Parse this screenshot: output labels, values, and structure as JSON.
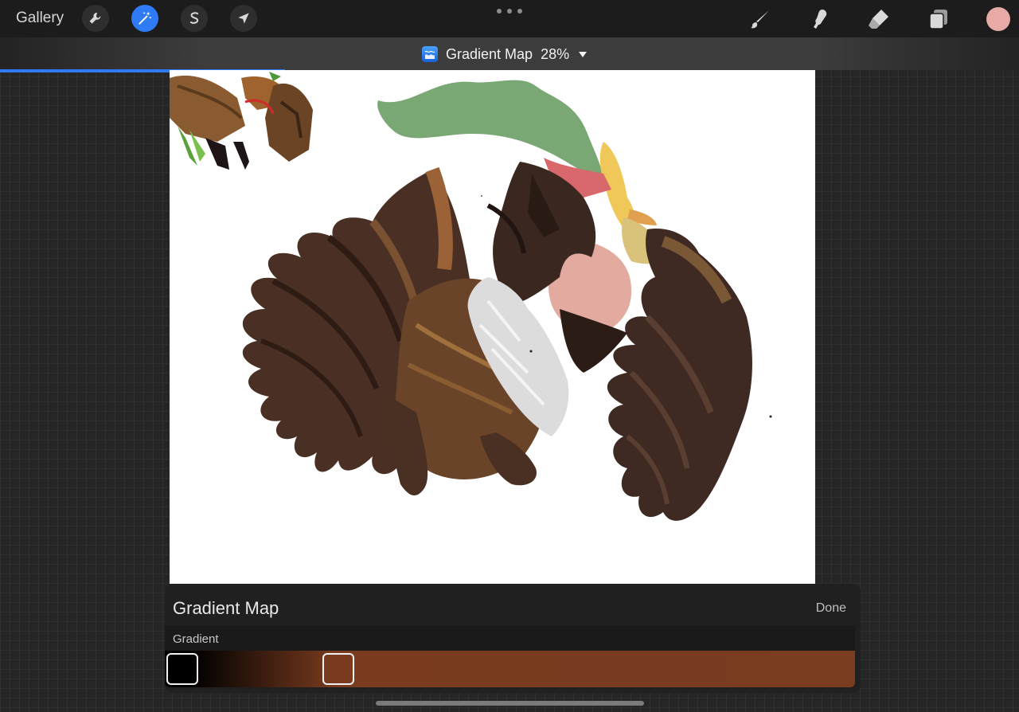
{
  "toolbar": {
    "gallery_label": "Gallery",
    "tools_left": [
      {
        "name": "actions",
        "icon": "wrench-icon",
        "active": false
      },
      {
        "name": "adjustments",
        "icon": "magic-wand-icon",
        "active": true
      },
      {
        "name": "selection",
        "icon": "selection-s-icon",
        "active": false
      },
      {
        "name": "transform",
        "icon": "arrow-cursor-icon",
        "active": false
      }
    ],
    "tools_right": [
      {
        "name": "brush",
        "icon": "brush-icon"
      },
      {
        "name": "smudge",
        "icon": "smudge-finger-icon"
      },
      {
        "name": "eraser",
        "icon": "eraser-icon"
      },
      {
        "name": "layers",
        "icon": "layers-icon"
      }
    ],
    "current_color": "#e8aaa4"
  },
  "adjustment_header": {
    "title": "Gradient Map",
    "percent": "28%",
    "icon": "gradient-map-icon",
    "progress_fraction": 0.28
  },
  "panel": {
    "title": "Gradient Map",
    "done_label": "Done",
    "gradient_label": "Gradient",
    "stops": [
      {
        "color": "#000000",
        "position": 0.0
      },
      {
        "color": "#7a3b1f",
        "position": 0.25
      }
    ],
    "end_color": "#7a3d20"
  },
  "colors": {
    "accent": "#2f7bf5",
    "panel_bg": "#202020"
  }
}
